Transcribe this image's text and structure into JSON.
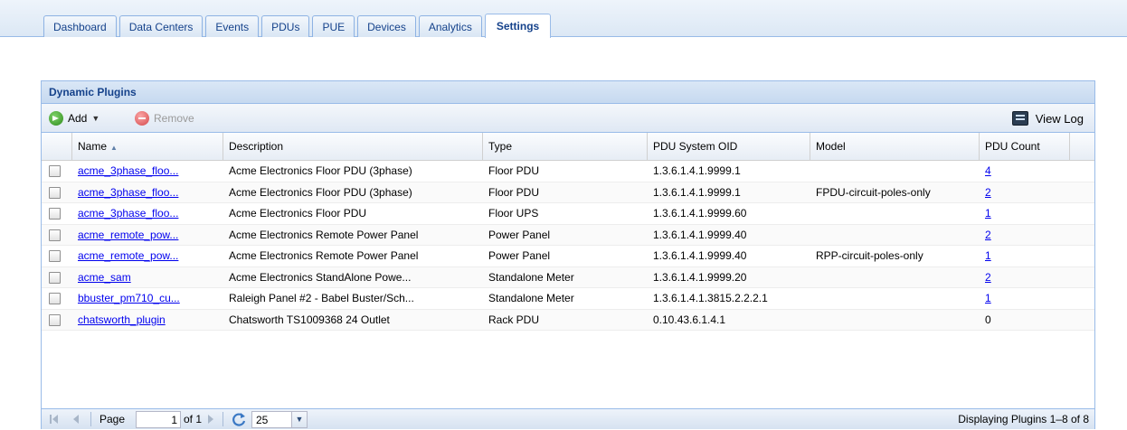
{
  "tabs": [
    {
      "label": "Dashboard",
      "active": false
    },
    {
      "label": "Data Centers",
      "active": false
    },
    {
      "label": "Events",
      "active": false
    },
    {
      "label": "PDUs",
      "active": false
    },
    {
      "label": "PUE",
      "active": false
    },
    {
      "label": "Devices",
      "active": false
    },
    {
      "label": "Analytics",
      "active": false
    },
    {
      "label": "Settings",
      "active": true
    }
  ],
  "panel": {
    "title": "Dynamic Plugins",
    "toolbar": {
      "add_label": "Add",
      "remove_label": "Remove",
      "view_log_label": "View Log"
    }
  },
  "grid": {
    "columns": [
      "Name",
      "Description",
      "Type",
      "PDU System OID",
      "Model",
      "PDU Count"
    ],
    "sort": {
      "column": "Name",
      "direction": "ascending"
    },
    "rows": [
      {
        "name": "acme_3phase_floo...",
        "description": "Acme Electronics Floor PDU (3phase)",
        "type": "Floor PDU",
        "oid": "1.3.6.1.4.1.9999.1",
        "model": "",
        "count": "4",
        "count_link": true
      },
      {
        "name": "acme_3phase_floo...",
        "description": "Acme Electronics Floor PDU (3phase)",
        "type": "Floor PDU",
        "oid": "1.3.6.1.4.1.9999.1",
        "model": "FPDU-circuit-poles-only",
        "count": "2",
        "count_link": true
      },
      {
        "name": "acme_3phase_floo...",
        "description": "Acme Electronics Floor PDU",
        "type": "Floor UPS",
        "oid": "1.3.6.1.4.1.9999.60",
        "model": "",
        "count": "1",
        "count_link": true
      },
      {
        "name": "acme_remote_pow...",
        "description": "Acme Electronics Remote Power Panel",
        "type": "Power Panel",
        "oid": "1.3.6.1.4.1.9999.40",
        "model": "",
        "count": "2",
        "count_link": true
      },
      {
        "name": "acme_remote_pow...",
        "description": "Acme Electronics Remote Power Panel",
        "type": "Power Panel",
        "oid": "1.3.6.1.4.1.9999.40",
        "model": "RPP-circuit-poles-only",
        "count": "1",
        "count_link": true
      },
      {
        "name": "acme_sam",
        "description": "Acme Electronics StandAlone Powe...",
        "type": "Standalone Meter",
        "oid": "1.3.6.1.4.1.9999.20",
        "model": "",
        "count": "2",
        "count_link": true
      },
      {
        "name": "bbuster_pm710_cu...",
        "description": "Raleigh Panel #2 - Babel Buster/Sch...",
        "type": "Standalone Meter",
        "oid": "1.3.6.1.4.1.3815.2.2.2.1",
        "model": "",
        "count": "1",
        "count_link": true
      },
      {
        "name": "chatsworth_plugin",
        "description": "Chatsworth TS1009368 24 Outlet",
        "type": "Rack PDU",
        "oid": "0.10.43.6.1.4.1",
        "model": "",
        "count": "0",
        "count_link": false
      }
    ]
  },
  "paging": {
    "page_label": "Page",
    "current_page": "1",
    "of_label": "of 1",
    "page_size": "25",
    "display_text": "Displaying Plugins 1–8 of 8"
  },
  "colors": {
    "accent": "#15428b",
    "border": "#99bbe8",
    "link": "#0000ee"
  }
}
